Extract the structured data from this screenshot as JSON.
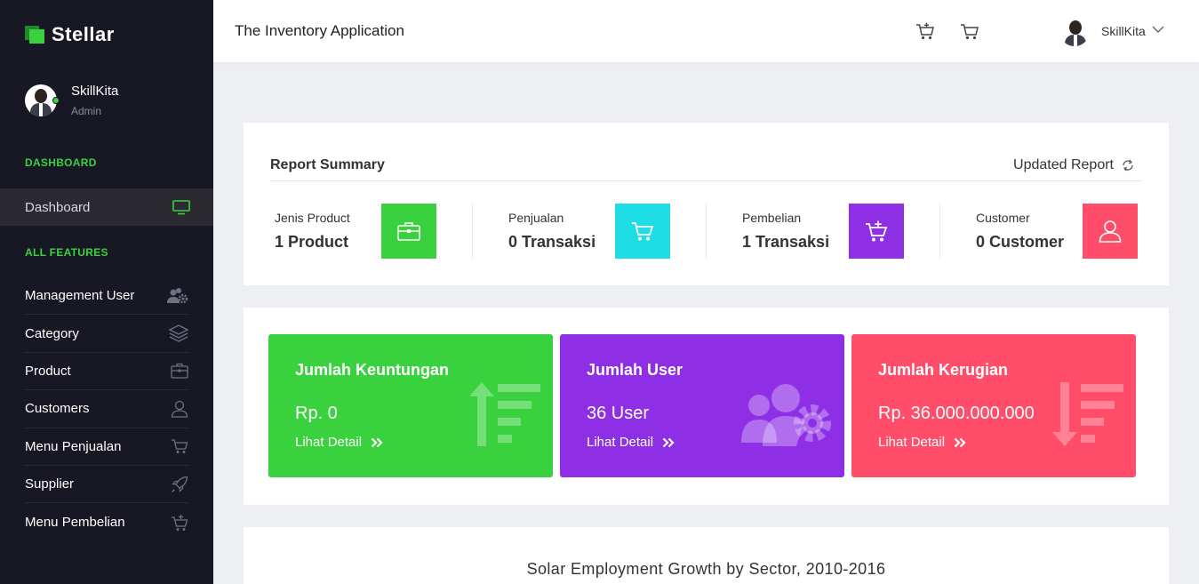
{
  "brand": {
    "name": "Stellar"
  },
  "profile": {
    "name": "SkillKita",
    "role": "Admin"
  },
  "sidebar": {
    "section_dashboard": "DASHBOARD",
    "dashboard_item": "Dashboard",
    "section_features": "ALL FEATURES",
    "items": [
      {
        "label": "Management User",
        "icon": "users-gear-icon"
      },
      {
        "label": "Category",
        "icon": "layers-icon"
      },
      {
        "label": "Product",
        "icon": "briefcase-icon"
      },
      {
        "label": "Customers",
        "icon": "user-icon"
      },
      {
        "label": "Menu Penjualan",
        "icon": "cart-icon"
      },
      {
        "label": "Supplier",
        "icon": "rocket-icon"
      },
      {
        "label": "Menu Pembelian",
        "icon": "cart-plus-icon"
      }
    ]
  },
  "header": {
    "title": "The Inventory Application",
    "user": "SkillKita"
  },
  "report": {
    "title": "Report Summary",
    "updated": "Updated Report",
    "stats": [
      {
        "label": "Jenis Product",
        "value": "1 Product",
        "color": "#3ad13f",
        "icon": "briefcase-icon"
      },
      {
        "label": "Penjualan",
        "value": "0 Transaksi",
        "color": "#1edde4",
        "icon": "cart-icon"
      },
      {
        "label": "Pembelian",
        "value": "1 Transaksi",
        "color": "#8e2fe6",
        "icon": "cart-plus-icon"
      },
      {
        "label": "Customer",
        "value": "0 Customer",
        "color": "#ff4d6a",
        "icon": "user-icon"
      }
    ]
  },
  "tiles": [
    {
      "title": "Jumlah Keuntungan",
      "value": "Rp. 0",
      "link": "Lihat Detail",
      "color": "#3ad13f",
      "icon": "sort-ascending-icon"
    },
    {
      "title": "Jumlah User",
      "value": "36 User",
      "link": "Lihat Detail",
      "color": "#8e2fe6",
      "icon": "users-gear-icon"
    },
    {
      "title": "Jumlah Kerugian",
      "value": "Rp. 36.000.000.000",
      "link": "Lihat Detail",
      "color": "#ff4d6a",
      "icon": "sort-descending-icon"
    }
  ],
  "chart": {
    "title": "Solar Employment Growth by Sector, 2010-2016"
  },
  "colors": {
    "sidebar_bg": "#181824",
    "accent": "#3ad13f",
    "page_bg": "#edeff3"
  }
}
